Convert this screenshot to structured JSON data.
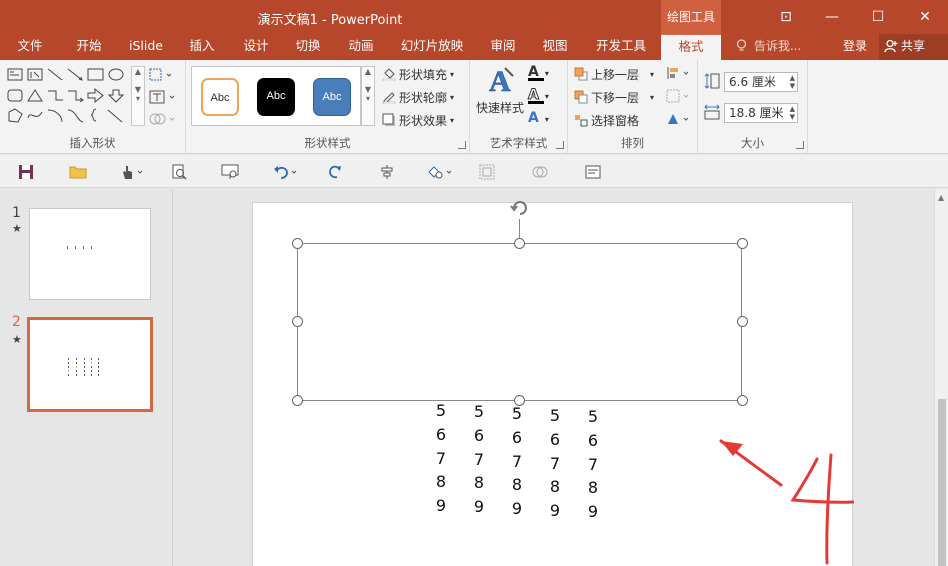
{
  "window": {
    "title": "演示文稿1 - PowerPoint",
    "context_tool_group": "绘图工具",
    "minimize_symbol": "—",
    "maximize_symbol": "☐",
    "close_symbol": "✕",
    "ribbon_display_symbol": "⊡"
  },
  "tabs": [
    {
      "label": "文件"
    },
    {
      "label": "开始"
    },
    {
      "label": "iSlide"
    },
    {
      "label": "插入"
    },
    {
      "label": "设计"
    },
    {
      "label": "切换"
    },
    {
      "label": "动画"
    },
    {
      "label": "幻灯片放映"
    },
    {
      "label": "审阅"
    },
    {
      "label": "视图"
    },
    {
      "label": "开发工具"
    },
    {
      "label": "格式"
    }
  ],
  "tell_me": "告诉我...",
  "login": "登录",
  "share": "共享",
  "ribbon": {
    "groups": {
      "insert_shapes": "插入形状",
      "shape_styles": "形状样式",
      "wordart_styles": "艺术字样式",
      "arrange": "排列",
      "size": "大小"
    },
    "style_thumbs": [
      "Abc",
      "Abc",
      "Abc"
    ],
    "shape_fill": "形状填充",
    "shape_outline": "形状轮廓",
    "shape_effects": "形状效果",
    "quick_styles": "快速样式",
    "wordart_letter": "A",
    "bring_forward": "上移一层",
    "send_backward": "下移一层",
    "selection_pane": "选择窗格",
    "height_value": "6.6 厘米",
    "width_value": "18.8 厘米"
  },
  "slides": [
    {
      "number": "1",
      "star": "★"
    },
    {
      "number": "2",
      "star": "★"
    }
  ],
  "slide_content": {
    "columns": [
      [
        "5",
        "6",
        "7",
        "8",
        "9"
      ],
      [
        "5",
        "6",
        "7",
        "8",
        "9"
      ],
      [
        "5",
        "6",
        "7",
        "8",
        "9"
      ],
      [
        "5",
        "6",
        "7",
        "8",
        "9"
      ],
      [
        "5",
        "6",
        "7",
        "8",
        "9"
      ]
    ],
    "annotation_number": "4",
    "annotation_color": "#e53935"
  },
  "colors": {
    "accent": "#b7472a",
    "active_thumb_border": "#d2693f",
    "style_blue": "#4a7ebb",
    "style_orange": "#f0a35a"
  }
}
